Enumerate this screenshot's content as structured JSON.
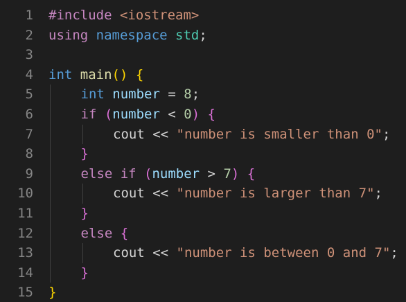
{
  "theme": {
    "background": "#1e1e1e",
    "line_number": "#858585",
    "default": "#d4d4d4",
    "keyword_blue": "#569cd6",
    "control_purple": "#c586c0",
    "string": "#ce9178",
    "number": "#b5cea8",
    "variable": "#9cdcfe",
    "function": "#dcdcaa",
    "type": "#4ec9b0",
    "bracket_gold": "#ffd700",
    "bracket_pink": "#da70d6",
    "bracket_blue": "#179fff"
  },
  "editor": {
    "lines": [
      {
        "number": "1",
        "indent": 0,
        "tokens": [
          {
            "text": "#include ",
            "color": "#c586c0"
          },
          {
            "text": "<iostream>",
            "color": "#ce9178"
          }
        ]
      },
      {
        "number": "2",
        "indent": 0,
        "tokens": [
          {
            "text": "using ",
            "color": "#c586c0"
          },
          {
            "text": "namespace ",
            "color": "#569cd6"
          },
          {
            "text": "std",
            "color": "#4ec9b0"
          },
          {
            "text": ";",
            "color": "#d4d4d4"
          }
        ]
      },
      {
        "number": "3",
        "indent": 0,
        "tokens": []
      },
      {
        "number": "4",
        "indent": 0,
        "tokens": [
          {
            "text": "int ",
            "color": "#569cd6"
          },
          {
            "text": "main",
            "color": "#dcdcaa"
          },
          {
            "text": "()",
            "color": "#ffd700"
          },
          {
            "text": " ",
            "color": "#d4d4d4"
          },
          {
            "text": "{",
            "color": "#ffd700"
          }
        ]
      },
      {
        "number": "5",
        "indent": 1,
        "tokens": [
          {
            "text": "int ",
            "color": "#569cd6"
          },
          {
            "text": "number",
            "color": "#9cdcfe"
          },
          {
            "text": " = ",
            "color": "#d4d4d4"
          },
          {
            "text": "8",
            "color": "#b5cea8"
          },
          {
            "text": ";",
            "color": "#d4d4d4"
          }
        ]
      },
      {
        "number": "6",
        "indent": 1,
        "tokens": [
          {
            "text": "if ",
            "color": "#c586c0"
          },
          {
            "text": "(",
            "color": "#da70d6"
          },
          {
            "text": "number",
            "color": "#9cdcfe"
          },
          {
            "text": " < ",
            "color": "#d4d4d4"
          },
          {
            "text": "0",
            "color": "#b5cea8"
          },
          {
            "text": ")",
            "color": "#da70d6"
          },
          {
            "text": " ",
            "color": "#d4d4d4"
          },
          {
            "text": "{",
            "color": "#da70d6"
          }
        ]
      },
      {
        "number": "7",
        "indent": 2,
        "tokens": [
          {
            "text": "cout",
            "color": "#d4d4d4"
          },
          {
            "text": " << ",
            "color": "#d4d4d4"
          },
          {
            "text": "\"number is smaller than 0\"",
            "color": "#ce9178"
          },
          {
            "text": ";",
            "color": "#d4d4d4"
          }
        ]
      },
      {
        "number": "8",
        "indent": 1,
        "tokens": [
          {
            "text": "}",
            "color": "#da70d6"
          }
        ]
      },
      {
        "number": "9",
        "indent": 1,
        "tokens": [
          {
            "text": "else if ",
            "color": "#c586c0"
          },
          {
            "text": "(",
            "color": "#da70d6"
          },
          {
            "text": "number",
            "color": "#9cdcfe"
          },
          {
            "text": " > ",
            "color": "#d4d4d4"
          },
          {
            "text": "7",
            "color": "#b5cea8"
          },
          {
            "text": ")",
            "color": "#da70d6"
          },
          {
            "text": " ",
            "color": "#d4d4d4"
          },
          {
            "text": "{",
            "color": "#da70d6"
          }
        ]
      },
      {
        "number": "10",
        "indent": 2,
        "tokens": [
          {
            "text": "cout",
            "color": "#d4d4d4"
          },
          {
            "text": " << ",
            "color": "#d4d4d4"
          },
          {
            "text": "\"number is larger than 7\"",
            "color": "#ce9178"
          },
          {
            "text": ";",
            "color": "#d4d4d4"
          }
        ]
      },
      {
        "number": "11",
        "indent": 1,
        "tokens": [
          {
            "text": "}",
            "color": "#da70d6"
          }
        ]
      },
      {
        "number": "12",
        "indent": 1,
        "tokens": [
          {
            "text": "else ",
            "color": "#c586c0"
          },
          {
            "text": "{",
            "color": "#da70d6"
          }
        ]
      },
      {
        "number": "13",
        "indent": 2,
        "tokens": [
          {
            "text": "cout",
            "color": "#d4d4d4"
          },
          {
            "text": " << ",
            "color": "#d4d4d4"
          },
          {
            "text": "\"number is between 0 and 7\"",
            "color": "#ce9178"
          },
          {
            "text": ";",
            "color": "#d4d4d4"
          }
        ]
      },
      {
        "number": "14",
        "indent": 1,
        "tokens": [
          {
            "text": "}",
            "color": "#da70d6"
          }
        ]
      },
      {
        "number": "15",
        "indent": 0,
        "tokens": [
          {
            "text": "}",
            "color": "#ffd700"
          }
        ]
      }
    ]
  }
}
